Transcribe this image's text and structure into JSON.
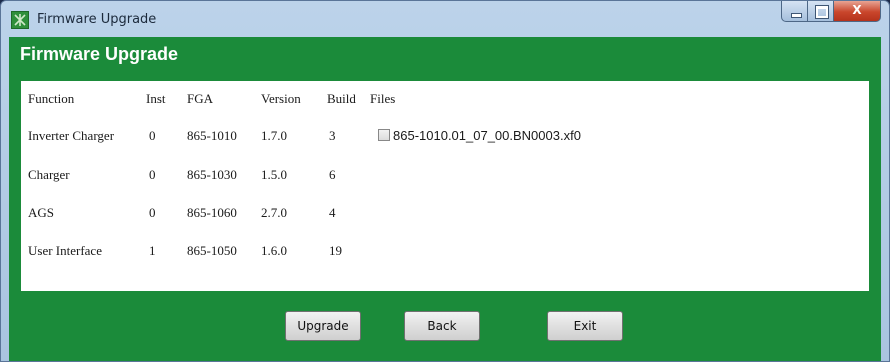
{
  "window": {
    "title": "Firmware Upgrade",
    "icon": "firmware-app-icon"
  },
  "header": {
    "title": "Firmware Upgrade"
  },
  "table": {
    "columns": [
      "Function",
      "Inst",
      "FGA",
      "Version",
      "Build",
      "Files"
    ],
    "rows": [
      {
        "function": "Inverter Charger",
        "inst": "0",
        "fga": "865-1010",
        "version": "1.7.0",
        "build": "3",
        "file": "865-1010.01_07_00.BN0003.xf0"
      },
      {
        "function": "Charger",
        "inst": "0",
        "fga": "865-1030",
        "version": "1.5.0",
        "build": "6"
      },
      {
        "function": "AGS",
        "inst": "0",
        "fga": "865-1060",
        "version": "2.7.0",
        "build": "4"
      },
      {
        "function": "User Interface",
        "inst": "1",
        "fga": "865-1050",
        "version": "1.6.0",
        "build": "19"
      }
    ]
  },
  "buttons": {
    "upgrade": "Upgrade",
    "back": "Back",
    "exit": "Exit"
  },
  "colors": {
    "header_green": "#1b8b3a",
    "titlebar_blue": "#bcd3ea"
  }
}
